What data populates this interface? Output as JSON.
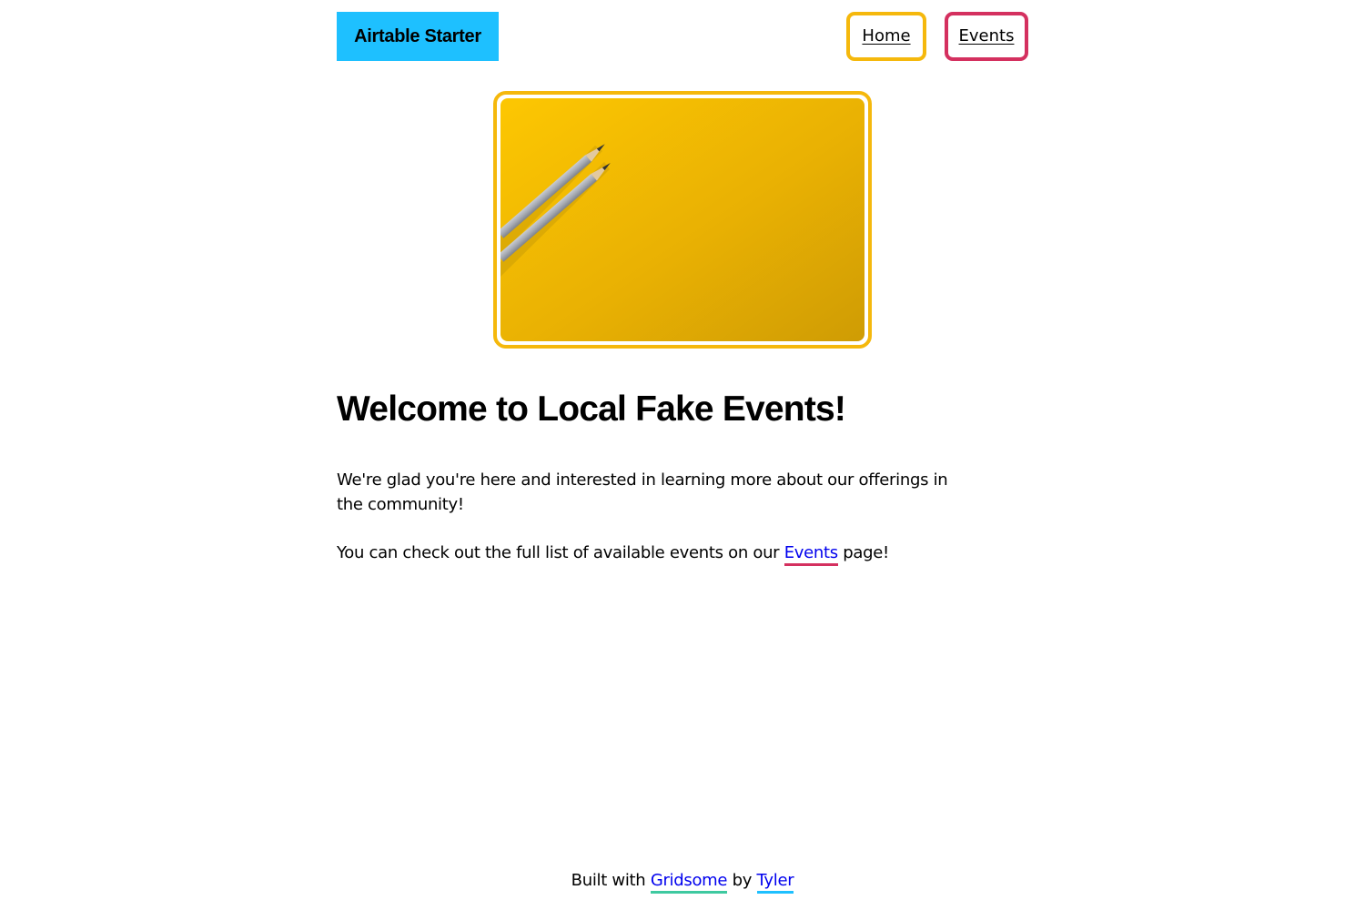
{
  "header": {
    "brand": "Airtable Starter",
    "nav": {
      "home": "Home",
      "events": "Events"
    }
  },
  "hero": {
    "icon": "pencils-on-yellow-image"
  },
  "main": {
    "title": "Welcome to Local Fake Events!",
    "paragraph1": "We're glad you're here and interested in learning more about our offerings in the community!",
    "paragraph2_before": "You can check out the full list of available events on our",
    "paragraph2_link": "Events",
    "paragraph2_after": "page!"
  },
  "footer": {
    "built_with": "Built with",
    "gridsome": "Gridsome",
    "by": "by",
    "author": "Tyler"
  },
  "colors": {
    "brand_bg": "#1ec0ff",
    "home_border": "#f5b80c",
    "events_border": "#d4305f",
    "hero_border": "#f5b80c",
    "gridsome_underline": "#3ec9a0",
    "author_underline": "#1ec0ff",
    "link_text": "#0000ee"
  }
}
